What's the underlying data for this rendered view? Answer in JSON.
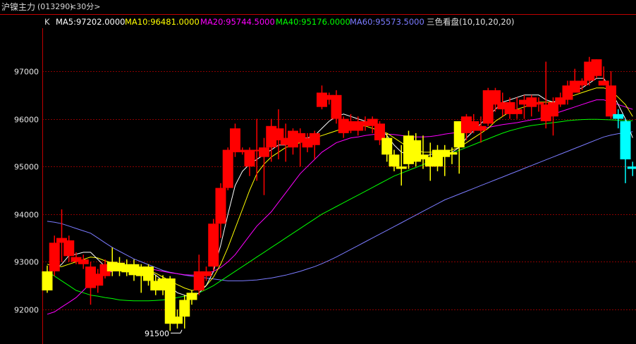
{
  "header": {
    "instrument": "沪镍主力",
    "code": "(013290)",
    "period": "<30分>"
  },
  "legend": {
    "k_label": "K",
    "ma5": "MA5:97202.0000",
    "ma10": "MA10:96481.0000",
    "ma20": "MA20:95744.5000",
    "ma40": "MA40:95176.0000",
    "ma60": "MA60:95573.5000",
    "indicator": "三色看盘(10,10,20,20)"
  },
  "colors": {
    "up": "#ff0000",
    "down": "#00ffff",
    "neutral": "#ffff00",
    "ma5": "#ffffff",
    "ma10": "#ffff00",
    "ma20": "#ff00ff",
    "ma40": "#00ff00",
    "ma60": "#7b7bff",
    "grid": "#8b0000",
    "axis": "#c00000"
  },
  "annotation": {
    "low_label": "91500"
  },
  "chart_data": {
    "type": "candlestick",
    "y_ticks": [
      "97000",
      "96000",
      "95000",
      "94000",
      "93000",
      "92000"
    ],
    "y_tick_values": [
      97000,
      96000,
      95000,
      94000,
      93000,
      92000
    ],
    "ylim": [
      91300,
      97700
    ],
    "candles": [
      {
        "o": 92400,
        "h": 92920,
        "l": 92350,
        "c": 92800,
        "k": "y"
      },
      {
        "o": 92800,
        "h": 93550,
        "l": 92700,
        "c": 93400,
        "k": "r"
      },
      {
        "o": 93400,
        "h": 94100,
        "l": 93000,
        "c": 93500,
        "k": "r"
      },
      {
        "o": 93450,
        "h": 93550,
        "l": 93000,
        "c": 93120,
        "k": "r"
      },
      {
        "o": 93100,
        "h": 93200,
        "l": 92950,
        "c": 93000,
        "k": "r"
      },
      {
        "o": 93050,
        "h": 93150,
        "l": 92850,
        "c": 92950,
        "k": "r"
      },
      {
        "o": 92900,
        "h": 93000,
        "l": 92100,
        "c": 92450,
        "k": "r"
      },
      {
        "o": 92500,
        "h": 92850,
        "l": 92350,
        "c": 92750,
        "k": "r"
      },
      {
        "o": 92700,
        "h": 93050,
        "l": 92650,
        "c": 92950,
        "k": "r"
      },
      {
        "o": 92800,
        "h": 93300,
        "l": 92700,
        "c": 93000,
        "k": "y"
      },
      {
        "o": 92980,
        "h": 93100,
        "l": 92700,
        "c": 92800,
        "k": "y"
      },
      {
        "o": 92780,
        "h": 93050,
        "l": 92700,
        "c": 92950,
        "k": "y"
      },
      {
        "o": 92950,
        "h": 93050,
        "l": 92600,
        "c": 92720,
        "k": "y"
      },
      {
        "o": 92700,
        "h": 92950,
        "l": 92350,
        "c": 92900,
        "k": "y"
      },
      {
        "o": 92900,
        "h": 92950,
        "l": 92500,
        "c": 92600,
        "k": "y"
      },
      {
        "o": 92600,
        "h": 92720,
        "l": 92300,
        "c": 92400,
        "k": "y"
      },
      {
        "o": 92400,
        "h": 92720,
        "l": 92300,
        "c": 92650,
        "k": "y"
      },
      {
        "o": 92650,
        "h": 92700,
        "l": 91550,
        "c": 91700,
        "k": "y"
      },
      {
        "o": 91700,
        "h": 92000,
        "l": 91600,
        "c": 91850,
        "k": "y"
      },
      {
        "o": 91850,
        "h": 92300,
        "l": 91600,
        "c": 92200,
        "k": "y"
      },
      {
        "o": 92200,
        "h": 92400,
        "l": 92100,
        "c": 92350,
        "k": "y"
      },
      {
        "o": 92400,
        "h": 93150,
        "l": 92300,
        "c": 92800,
        "k": "r"
      },
      {
        "o": 92700,
        "h": 92900,
        "l": 92600,
        "c": 92800,
        "k": "r"
      },
      {
        "o": 92900,
        "h": 93900,
        "l": 92800,
        "c": 93800,
        "k": "r"
      },
      {
        "o": 93800,
        "h": 94650,
        "l": 93500,
        "c": 94550,
        "k": "r"
      },
      {
        "o": 94550,
        "h": 95400,
        "l": 94500,
        "c": 95350,
        "k": "r"
      },
      {
        "o": 95300,
        "h": 95900,
        "l": 95200,
        "c": 95800,
        "k": "r"
      },
      {
        "o": 95300,
        "h": 95400,
        "l": 95250,
        "c": 95350,
        "k": "r"
      },
      {
        "o": 95350,
        "h": 95400,
        "l": 94800,
        "c": 95000,
        "k": "r"
      },
      {
        "o": 95350,
        "h": 96000,
        "l": 94700,
        "c": 95350,
        "k": "r"
      },
      {
        "o": 95200,
        "h": 95600,
        "l": 94400,
        "c": 95400,
        "k": "r"
      },
      {
        "o": 95400,
        "h": 96000,
        "l": 95100,
        "c": 95850,
        "k": "r"
      },
      {
        "o": 95800,
        "h": 96200,
        "l": 95150,
        "c": 95550,
        "k": "r"
      },
      {
        "o": 95450,
        "h": 95900,
        "l": 95100,
        "c": 95600,
        "k": "r"
      },
      {
        "o": 95750,
        "h": 95800,
        "l": 95250,
        "c": 95400,
        "k": "r"
      },
      {
        "o": 95500,
        "h": 95800,
        "l": 95000,
        "c": 95700,
        "k": "r"
      },
      {
        "o": 95400,
        "h": 95700,
        "l": 95300,
        "c": 95600,
        "k": "r"
      },
      {
        "o": 95450,
        "h": 95750,
        "l": 95150,
        "c": 95700,
        "k": "r"
      },
      {
        "o": 96250,
        "h": 96700,
        "l": 96200,
        "c": 96550,
        "k": "r"
      },
      {
        "o": 96500,
        "h": 96550,
        "l": 96300,
        "c": 96400,
        "k": "r"
      },
      {
        "o": 96500,
        "h": 96600,
        "l": 95900,
        "c": 96000,
        "k": "r"
      },
      {
        "o": 96000,
        "h": 96050,
        "l": 95600,
        "c": 95700,
        "k": "r"
      },
      {
        "o": 95750,
        "h": 96100,
        "l": 95700,
        "c": 95950,
        "k": "r"
      },
      {
        "o": 95950,
        "h": 96050,
        "l": 95650,
        "c": 95750,
        "k": "r"
      },
      {
        "o": 95850,
        "h": 96050,
        "l": 95750,
        "c": 95950,
        "k": "r"
      },
      {
        "o": 96000,
        "h": 96050,
        "l": 95700,
        "c": 95850,
        "k": "r"
      },
      {
        "o": 95900,
        "h": 95950,
        "l": 95450,
        "c": 95550,
        "k": "r"
      },
      {
        "o": 95600,
        "h": 95700,
        "l": 95100,
        "c": 95250,
        "k": "y"
      },
      {
        "o": 95250,
        "h": 95350,
        "l": 94900,
        "c": 95000,
        "k": "y"
      },
      {
        "o": 95000,
        "h": 95450,
        "l": 94600,
        "c": 94950,
        "k": "y"
      },
      {
        "o": 95050,
        "h": 95750,
        "l": 94950,
        "c": 95650,
        "k": "y"
      },
      {
        "o": 95550,
        "h": 95700,
        "l": 95000,
        "c": 95100,
        "k": "y"
      },
      {
        "o": 95150,
        "h": 95650,
        "l": 94950,
        "c": 95250,
        "k": "y"
      },
      {
        "o": 95200,
        "h": 95500,
        "l": 94700,
        "c": 95000,
        "k": "y"
      },
      {
        "o": 95000,
        "h": 95450,
        "l": 94900,
        "c": 95350,
        "k": "y"
      },
      {
        "o": 95350,
        "h": 95450,
        "l": 94800,
        "c": 95200,
        "k": "y"
      },
      {
        "o": 95300,
        "h": 95400,
        "l": 95050,
        "c": 95250,
        "k": "y"
      },
      {
        "o": 95400,
        "h": 95950,
        "l": 94850,
        "c": 95950,
        "k": "y"
      },
      {
        "o": 95700,
        "h": 96100,
        "l": 95550,
        "c": 96050,
        "k": "r"
      },
      {
        "o": 95750,
        "h": 96100,
        "l": 95700,
        "c": 95950,
        "k": "r"
      },
      {
        "o": 95750,
        "h": 96050,
        "l": 95500,
        "c": 95850,
        "k": "r"
      },
      {
        "o": 95900,
        "h": 96650,
        "l": 95850,
        "c": 96600,
        "k": "r"
      },
      {
        "o": 96300,
        "h": 96650,
        "l": 96150,
        "c": 96600,
        "k": "r"
      },
      {
        "o": 96200,
        "h": 96550,
        "l": 96050,
        "c": 96350,
        "k": "r"
      },
      {
        "o": 96100,
        "h": 96450,
        "l": 96000,
        "c": 96350,
        "k": "r"
      },
      {
        "o": 96100,
        "h": 96450,
        "l": 96000,
        "c": 96200,
        "k": "r"
      },
      {
        "o": 96300,
        "h": 96500,
        "l": 96000,
        "c": 96400,
        "k": "r"
      },
      {
        "o": 96250,
        "h": 96500,
        "l": 96050,
        "c": 96450,
        "k": "r"
      },
      {
        "o": 96300,
        "h": 96450,
        "l": 96150,
        "c": 96350,
        "k": "r"
      },
      {
        "o": 95950,
        "h": 97200,
        "l": 95800,
        "c": 96300,
        "k": "r"
      },
      {
        "o": 96050,
        "h": 96450,
        "l": 95650,
        "c": 96350,
        "k": "r"
      },
      {
        "o": 96300,
        "h": 96550,
        "l": 96250,
        "c": 96450,
        "k": "r"
      },
      {
        "o": 96400,
        "h": 96800,
        "l": 96300,
        "c": 96700,
        "k": "r"
      },
      {
        "o": 96550,
        "h": 97050,
        "l": 96550,
        "c": 96800,
        "k": "r"
      },
      {
        "o": 96700,
        "h": 96850,
        "l": 96600,
        "c": 96800,
        "k": "r"
      },
      {
        "o": 96800,
        "h": 97300,
        "l": 96700,
        "c": 97200,
        "k": "r"
      },
      {
        "o": 97250,
        "h": 97250,
        "l": 96850,
        "c": 96900,
        "k": "r"
      },
      {
        "o": 96800,
        "h": 97100,
        "l": 96700,
        "c": 96700,
        "k": "r"
      },
      {
        "o": 96700,
        "h": 97000,
        "l": 96000,
        "c": 96050,
        "k": "r"
      },
      {
        "o": 96100,
        "h": 96200,
        "l": 95800,
        "c": 96000,
        "k": "c"
      },
      {
        "o": 95950,
        "h": 96000,
        "l": 94650,
        "c": 95150,
        "k": "c"
      },
      {
        "o": 95000,
        "h": 95100,
        "l": 94800,
        "c": 94950,
        "k": "c"
      }
    ],
    "ma5": [
      92750,
      92830,
      92950,
      93130,
      93160,
      93200,
      93200,
      93050,
      92900,
      92880,
      92850,
      92880,
      92880,
      92870,
      92820,
      92720,
      92600,
      92480,
      92350,
      92300,
      92250,
      92350,
      92500,
      92800,
      93350,
      94000,
      94600,
      94900,
      95050,
      95150,
      95250,
      95350,
      95450,
      95450,
      95550,
      95600,
      95600,
      95650,
      95800,
      95950,
      96050,
      96100,
      96050,
      96000,
      95950,
      95900,
      95800,
      95650,
      95450,
      95300,
      95250,
      95200,
      95200,
      95250,
      95300,
      95250,
      95300,
      95400,
      95600,
      95750,
      95900,
      96050,
      96200,
      96350,
      96400,
      96450,
      96500,
      96500,
      96500,
      96400,
      96350,
      96400,
      96500,
      96600,
      96650,
      96750,
      96850,
      96850,
      96600,
      96300,
      96000,
      95600
    ],
    "ma10": [
      92950,
      92900,
      92900,
      92950,
      93000,
      93050,
      93100,
      93080,
      93020,
      92980,
      92950,
      92900,
      92880,
      92860,
      92820,
      92760,
      92680,
      92600,
      92520,
      92450,
      92400,
      92420,
      92500,
      92680,
      92950,
      93300,
      93700,
      94100,
      94500,
      94850,
      95050,
      95200,
      95300,
      95400,
      95450,
      95500,
      95550,
      95600,
      95650,
      95700,
      95750,
      95800,
      95850,
      95850,
      95850,
      95800,
      95750,
      95700,
      95600,
      95500,
      95400,
      95350,
      95300,
      95300,
      95300,
      95300,
      95350,
      95400,
      95500,
      95600,
      95700,
      95800,
      95950,
      96050,
      96150,
      96200,
      96250,
      96300,
      96350,
      96350,
      96350,
      96400,
      96450,
      96500,
      96550,
      96600,
      96650,
      96650,
      96600,
      96450,
      96300,
      96050
    ],
    "ma20": [
      91900,
      91950,
      92050,
      92150,
      92250,
      92400,
      92550,
      92650,
      92750,
      92800,
      92850,
      92850,
      92850,
      92850,
      92850,
      92830,
      92800,
      92770,
      92750,
      92730,
      92720,
      92720,
      92750,
      92800,
      92880,
      93000,
      93150,
      93350,
      93550,
      93750,
      93900,
      94050,
      94250,
      94450,
      94650,
      94850,
      95000,
      95150,
      95300,
      95400,
      95500,
      95550,
      95600,
      95620,
      95650,
      95670,
      95680,
      95680,
      95670,
      95650,
      95630,
      95620,
      95620,
      95630,
      95650,
      95680,
      95700,
      95720,
      95750,
      95780,
      95800,
      95820,
      95850,
      95880,
      95900,
      95920,
      95950,
      95980,
      96000,
      96050,
      96100,
      96150,
      96200,
      96250,
      96300,
      96350,
      96400,
      96400,
      96350,
      96300,
      96250,
      96200
    ],
    "ma40": [
      92800,
      92700,
      92600,
      92500,
      92400,
      92350,
      92300,
      92280,
      92250,
      92230,
      92200,
      92190,
      92180,
      92180,
      92180,
      92190,
      92200,
      92220,
      92250,
      92280,
      92300,
      92350,
      92420,
      92500,
      92600,
      92700,
      92800,
      92900,
      93000,
      93100,
      93200,
      93300,
      93400,
      93500,
      93600,
      93700,
      93800,
      93900,
      94000,
      94080,
      94160,
      94240,
      94320,
      94400,
      94480,
      94560,
      94640,
      94720,
      94800,
      94860,
      94920,
      94980,
      95040,
      95100,
      95160,
      95220,
      95280,
      95340,
      95400,
      95460,
      95520,
      95580,
      95640,
      95700,
      95750,
      95790,
      95830,
      95860,
      95880,
      95900,
      95920,
      95940,
      95960,
      95975,
      95985,
      95990,
      95990,
      95985,
      95980,
      95970,
      95965,
      95960
    ],
    "ma60": [
      93850,
      93830,
      93800,
      93750,
      93700,
      93650,
      93600,
      93500,
      93400,
      93300,
      93220,
      93140,
      93060,
      93000,
      92940,
      92880,
      92820,
      92780,
      92750,
      92720,
      92700,
      92680,
      92660,
      92640,
      92620,
      92600,
      92600,
      92600,
      92610,
      92620,
      92640,
      92660,
      92690,
      92720,
      92760,
      92800,
      92850,
      92900,
      92960,
      93030,
      93100,
      93180,
      93260,
      93340,
      93420,
      93500,
      93580,
      93660,
      93740,
      93820,
      93900,
      93980,
      94060,
      94140,
      94220,
      94300,
      94360,
      94420,
      94480,
      94540,
      94600,
      94660,
      94720,
      94780,
      94840,
      94900,
      94960,
      95020,
      95080,
      95140,
      95200,
      95260,
      95320,
      95380,
      95440,
      95500,
      95560,
      95620,
      95660,
      95690,
      95710,
      95730
    ]
  }
}
